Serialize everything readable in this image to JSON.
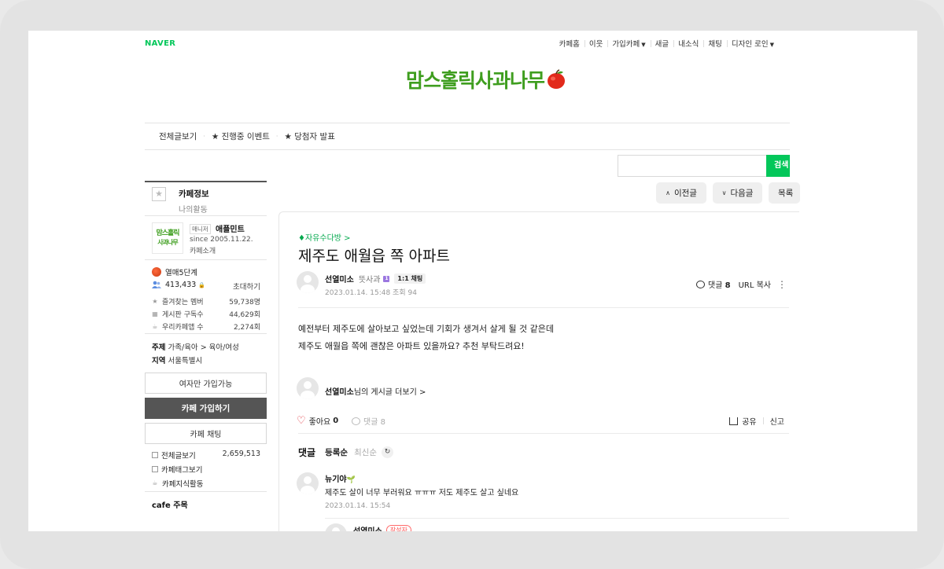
{
  "gnb": {
    "logo": "NAVER",
    "items": [
      "카페홈",
      "이웃",
      "가입카페",
      "새글",
      "내소식",
      "채팅",
      "디자인 로인"
    ]
  },
  "banner": {
    "title": "맘스홀릭사과나무"
  },
  "menubar": {
    "items": [
      "전체글보기",
      "★ 진행중 이벤트",
      "★ 당첨자 발표"
    ]
  },
  "search": {
    "button": "검색",
    "placeholder": ""
  },
  "nav": {
    "prev": "이전글",
    "next": "다음글",
    "list": "목록"
  },
  "sidebar": {
    "tab_info": "카페정보",
    "tab_my": "나의활동",
    "logo_line1": "맘스홀릭",
    "logo_line2": "사과나무",
    "manager_badge": "매니저",
    "manager_name": "애플민트",
    "since": "since 2005.11.22.",
    "intro": "카페소개",
    "grade": "열매5단계",
    "members": "413,433",
    "invite": "초대하기",
    "stats": [
      {
        "label": "즐겨찾는 멤버",
        "value": "59,738명"
      },
      {
        "label": "게시판 구독수",
        "value": "44,629회"
      },
      {
        "label": "우리카페앱 수",
        "value": "2,274회"
      }
    ],
    "topic_label": "주제",
    "topic_value": "가족/육아 > 육아/여성",
    "region_label": "지역",
    "region_value": "서울특별시",
    "btn_female": "여자만 가입가능",
    "btn_join": "카페 가입하기",
    "btn_chat": "카페 채팅",
    "link_all": "전체글보기",
    "link_all_count": "2,659,513",
    "link_tag": "카페태그보기",
    "link_knowledge": "카페지식활동",
    "notice": "cafe 주목"
  },
  "article": {
    "board": "♦자유수다방 >",
    "title": "제주도 애월읍 쪽 아파트",
    "author": "선열미소",
    "level": "뜻사과",
    "level_badge": "1",
    "chat_chip": "1:1 채팅",
    "date": "2023.01.14. 15:48  조회 94",
    "comment_label": "댓글",
    "comment_count": "8",
    "url_copy": "URL 복사",
    "body": [
      "예전부터 제주도에 살아보고 싶었는데 기회가 생겨서 살게 될 것 같은데",
      "제주도 애월읍 쪽에 괜찮은 아파트 있을까요? 추천 부탁드려요!"
    ],
    "more_author": "선열미소",
    "more_suffix": "님의 게시글 더보기 >",
    "like_label": "좋아요",
    "like_count": "0",
    "comment2": "댓글 8",
    "share": "공유",
    "report": "신고"
  },
  "comments": {
    "header": "댓글",
    "sort_reg": "등록순",
    "sort_new": "최신순",
    "items": [
      {
        "author": "뉴기야",
        "text": "제주도 살이 너무 부러워요 ㅠㅠㅠ 저도 제주도 살고 싶네요",
        "date": "2023.01.14. 15:54"
      }
    ],
    "reply_author": "선열미소",
    "writer_badge": "작성자"
  },
  "colors": {
    "accent": "#03c75a",
    "brand_green": "#3f9e1f",
    "heart": "#e0323b"
  }
}
